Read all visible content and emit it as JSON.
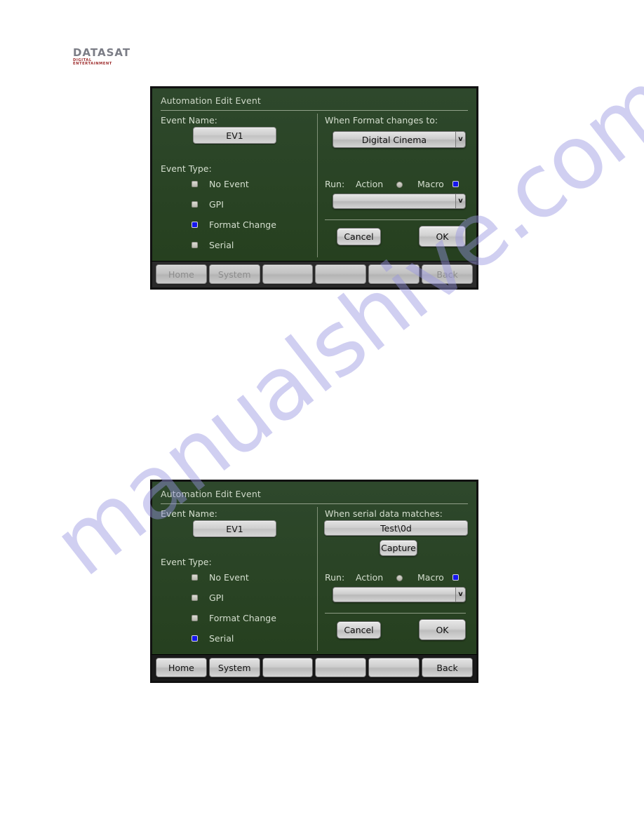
{
  "brand": {
    "name_part1": "D",
    "name_full": "DATASAT",
    "tagline": "DIGITAL ENTERTAINMENT"
  },
  "watermark": {
    "text": "manualshive.com"
  },
  "panels": [
    {
      "id": "format-change-panel",
      "title": "Automation Edit Event",
      "event_name_label": "Event Name:",
      "event_name_value": "EV1",
      "event_type_label": "Event Type:",
      "event_types": [
        {
          "label": "No Event",
          "selected": false
        },
        {
          "label": "GPI",
          "selected": false
        },
        {
          "label": "Format Change",
          "selected": true
        },
        {
          "label": "Serial",
          "selected": false
        }
      ],
      "condition_label": "When Format changes to:",
      "condition_value": "Digital Cinema",
      "condition_arrow": "v",
      "run_label": "Run:",
      "run_action_label": "Action",
      "run_action_selected": false,
      "run_macro_label": "Macro",
      "run_macro_selected": true,
      "macro_select_value": "",
      "macro_select_arrow": "v",
      "cancel_label": "Cancel",
      "ok_label": "OK",
      "softkeys": [
        "Home",
        "System",
        "",
        "",
        "",
        "Back"
      ]
    },
    {
      "id": "serial-panel",
      "title": "Automation Edit Event",
      "event_name_label": "Event Name:",
      "event_name_value": "EV1",
      "event_type_label": "Event Type:",
      "event_types": [
        {
          "label": "No Event",
          "selected": false
        },
        {
          "label": "GPI",
          "selected": false
        },
        {
          "label": "Format Change",
          "selected": false
        },
        {
          "label": "Serial",
          "selected": true
        }
      ],
      "condition_label": "When serial data matches:",
      "condition_value": "Test\\0d",
      "capture_label": "Capture",
      "run_label": "Run:",
      "run_action_label": "Action",
      "run_action_selected": false,
      "run_macro_label": "Macro",
      "run_macro_selected": true,
      "macro_select_value": "",
      "macro_select_arrow": "v",
      "cancel_label": "Cancel",
      "ok_label": "OK",
      "softkeys": [
        "Home",
        "System",
        "",
        "",
        "",
        "Back"
      ]
    }
  ],
  "colors": {
    "screen_green": "#2b4429",
    "selected_blue": "#1616ef",
    "bezel": "#1b1b1b",
    "brand_red": "#a03030",
    "watermark": "#9694e1"
  }
}
